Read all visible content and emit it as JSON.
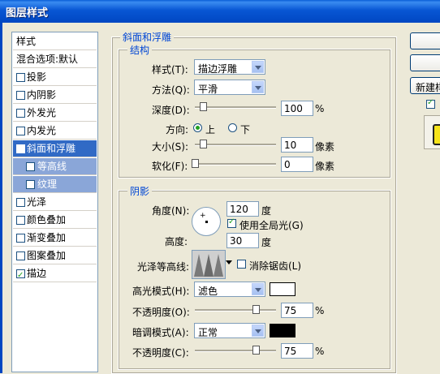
{
  "window": {
    "title": "图层样式"
  },
  "styles_list": {
    "items": [
      {
        "label": "样式",
        "has_checkbox": false,
        "checked": false,
        "state": "plain"
      },
      {
        "label": "混合选项:默认",
        "has_checkbox": false,
        "checked": false,
        "state": "plain"
      },
      {
        "label": "投影",
        "has_checkbox": true,
        "checked": false,
        "state": "normal"
      },
      {
        "label": "内阴影",
        "has_checkbox": true,
        "checked": false,
        "state": "normal"
      },
      {
        "label": "外发光",
        "has_checkbox": true,
        "checked": false,
        "state": "normal"
      },
      {
        "label": "内发光",
        "has_checkbox": true,
        "checked": false,
        "state": "normal"
      },
      {
        "label": "斜面和浮雕",
        "has_checkbox": true,
        "checked": true,
        "state": "selected"
      },
      {
        "label": "等高线",
        "has_checkbox": true,
        "checked": false,
        "state": "sub"
      },
      {
        "label": "纹理",
        "has_checkbox": true,
        "checked": false,
        "state": "sub"
      },
      {
        "label": "光泽",
        "has_checkbox": true,
        "checked": false,
        "state": "normal"
      },
      {
        "label": "颜色叠加",
        "has_checkbox": true,
        "checked": false,
        "state": "normal"
      },
      {
        "label": "渐变叠加",
        "has_checkbox": true,
        "checked": false,
        "state": "normal"
      },
      {
        "label": "图案叠加",
        "has_checkbox": true,
        "checked": false,
        "state": "normal"
      },
      {
        "label": "描边",
        "has_checkbox": true,
        "checked": true,
        "state": "normal"
      }
    ]
  },
  "bevel": {
    "group_title": "斜面和浮雕",
    "structure": {
      "title": "结构",
      "style_label": "样式(T):",
      "style_value": "描边浮雕",
      "technique_label": "方法(Q):",
      "technique_value": "平滑",
      "depth_label": "深度(D):",
      "depth_value": "100",
      "depth_unit": "%",
      "depth_slider_fraction": 0.1,
      "direction_label": "方向:",
      "direction_up": "上",
      "direction_down": "下",
      "direction_selected": "up",
      "size_label": "大小(S):",
      "size_value": "10",
      "size_unit": "像素",
      "size_slider_fraction": 0.1,
      "soften_label": "软化(F):",
      "soften_value": "0",
      "soften_unit": "像素",
      "soften_slider_fraction": 0.0
    },
    "shading": {
      "title": "阴影",
      "angle_label": "角度(N):",
      "angle_value": "120",
      "angle_unit": "度",
      "global_light_label": "使用全局光(G)",
      "global_light_checked": true,
      "altitude_label": "高度:",
      "altitude_value": "30",
      "altitude_unit": "度",
      "gloss_contour_label": "光泽等高线:",
      "anti_aliased_label": "消除锯齿(L)",
      "anti_aliased_checked": false,
      "highlight_mode_label": "高光模式(H):",
      "highlight_mode_value": "滤色",
      "highlight_color": "#ffffff",
      "highlight_opacity_label": "不透明度(O):",
      "highlight_opacity_value": "75",
      "highlight_opacity_unit": "%",
      "highlight_opacity_fraction": 0.75,
      "shadow_mode_label": "暗调模式(A):",
      "shadow_mode_value": "正常",
      "shadow_color": "#000000",
      "shadow_opacity_label": "不透明度(C):",
      "shadow_opacity_value": "75",
      "shadow_opacity_unit": "%",
      "shadow_opacity_fraction": 0.75
    }
  },
  "right_panel": {
    "new_style_label": "新建样",
    "preview_checked": true
  },
  "colors": {
    "accent": "#0046d5",
    "selection": "#316ac5",
    "subselection": "#8aa6d8"
  }
}
